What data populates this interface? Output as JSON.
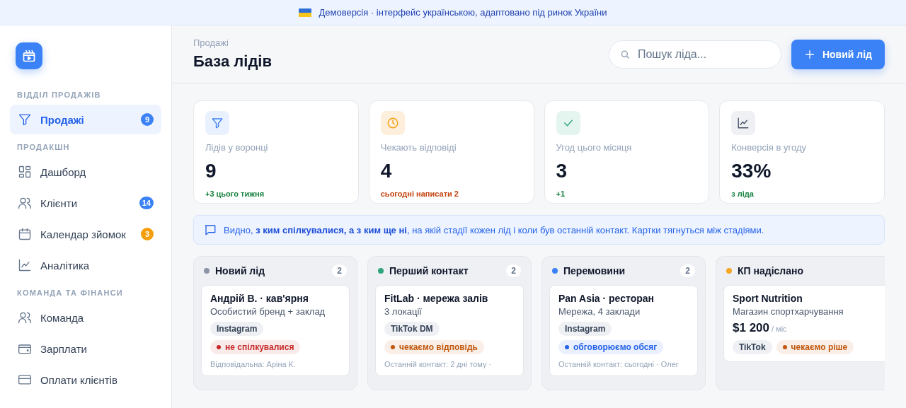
{
  "banner": {
    "text": "Демоверсія · інтерфейс українською, адаптовано під ринок України"
  },
  "sidebar": {
    "sections": [
      {
        "title": "ВІДДІЛ ПРОДАЖІВ",
        "items": [
          {
            "kind": "funnel",
            "label": "Продажі",
            "selected": true,
            "badge": "9",
            "color": "#3b82f6"
          }
        ]
      },
      {
        "title": "ПРОДАКШН",
        "items": [
          {
            "kind": "grid",
            "label": "Дашборд",
            "selected": false
          },
          {
            "kind": "users",
            "label": "Клієнти",
            "selected": false,
            "badge": "14",
            "color": "#3b82f6"
          },
          {
            "kind": "calendar",
            "label": "Календар зйомок",
            "selected": false,
            "badge": "3",
            "color": "#f59e0b"
          },
          {
            "kind": "chart",
            "label": "Аналітика",
            "selected": false
          }
        ]
      },
      {
        "title": "КОМАНДА ТА ФІНАНСИ",
        "items": [
          {
            "kind": "users",
            "label": "Команда",
            "selected": false
          },
          {
            "kind": "wallet",
            "label": "Зарплати",
            "selected": false
          },
          {
            "kind": "card",
            "label": "Оплати клієнтів",
            "selected": false
          }
        ]
      }
    ]
  },
  "header": {
    "breadcrumb": "Продажі",
    "title": "База лідів",
    "search": {
      "placeholder": "Пошук ліда..."
    },
    "button": "Новий лід"
  },
  "stats": [
    {
      "kind": "funnel",
      "label": "Лідів у воронці",
      "value": "9",
      "note": "+3 цього тижня",
      "color": "#15803d"
    },
    {
      "kind": "clock",
      "label": "Чекають відповіді",
      "value": "4",
      "note": "сьогодні написати 2",
      "color": "#c2410c"
    },
    {
      "kind": "check",
      "label": "Угод цього місяця",
      "value": "3",
      "note": "+1",
      "color": "#15803d"
    },
    {
      "kind": "chart",
      "label": "Конверсія в угоду",
      "value": "33%",
      "note": "з ліда",
      "color": "#15803d"
    }
  ],
  "info": "Видно, **з ким спілкувалися, а з ким ще ні**, на якій стадії кожен лід і коли був останній контакт. Картки тягнуться між стадіями.",
  "columns": [
    {
      "title": "Новий лід",
      "color": "#8b95a5",
      "count": "2",
      "cards": [
        {
          "title": "Андрій В. · кав'ярня",
          "subtitle": "Особистий бренд + заклад",
          "one_row": false,
          "tag": "Instagram",
          "status": {
            "label": "не спілкувалися",
            "color": "#c62828"
          },
          "footer": "Відповідальна: Аріна К."
        }
      ]
    },
    {
      "title": "Перший контакт",
      "color": "#2fa57a",
      "count": "2",
      "cards": [
        {
          "title": "FitLab · мережа залів",
          "subtitle": "3 локації",
          "one_row": false,
          "tag": "TikTok DM",
          "status": {
            "label": "чекаємо відповідь",
            "color": "#c2570c"
          },
          "footer": "Останній контакт: 2 дні тому ·"
        }
      ]
    },
    {
      "title": "Перемовини",
      "color": "#3b82f6",
      "count": "2",
      "cards": [
        {
          "title": "Pan Asia · ресторан",
          "subtitle": "Мережа, 4 заклади",
          "one_row": false,
          "tag": "Instagram",
          "status": {
            "label": "обговорюємо обсяг",
            "color": "#2563eb"
          },
          "footer": "Останній контакт: сьогодні · Олег"
        }
      ]
    },
    {
      "title": "КП надіслано",
      "color": "#f5a623",
      "cards": [
        {
          "title": "Sport Nutrition",
          "subtitle": "Магазин спортхарчування",
          "price": "$1 200",
          "price_unit": "/ міс",
          "one_row": true,
          "tag": "TikTok",
          "status": {
            "label": "чекаємо ріше",
            "color": "#c2570c"
          }
        }
      ]
    }
  ]
}
